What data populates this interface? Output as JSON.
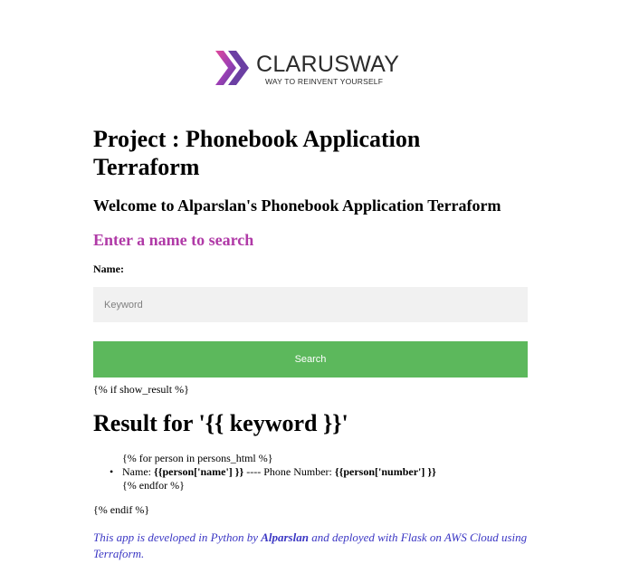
{
  "logo": {
    "name": "CLARUSWAY",
    "tagline": "WAY TO REINVENT YOURSELF",
    "icon": "clarusway-chevrons-logo",
    "colors": [
      "#e0499b",
      "#9b3fb5",
      "#5a3f98"
    ]
  },
  "header": {
    "title": "Project : Phonebook Application Terraform",
    "welcome": "Welcome to Alparslan's Phonebook Application Terraform"
  },
  "search": {
    "heading": "Enter a name to search",
    "label": "Name:",
    "placeholder": "Keyword",
    "value": "",
    "button": "Search"
  },
  "template": {
    "if_line": "{% if show_result %}",
    "result_heading": "Result for '{{ keyword }}'",
    "for_line": "{% for person in persons_html %}",
    "name_prefix": "Name: ",
    "name_expr": "{{person['name'] }}",
    "separator": " ---- Phone Number: ",
    "number_expr": "{{person['number'] }}",
    "endfor_line": "{% endfor %}",
    "endif_line": "{% endif %}",
    "bullet": "•"
  },
  "footer": {
    "prefix": "This app is developed in Python by ",
    "author": "Alparslan",
    "suffix": " and deployed with Flask on AWS Cloud using Terraform."
  },
  "colors": {
    "heading_purple": "#b03aa7",
    "button_green": "#5cb85c",
    "footer_blue": "#3b37c4",
    "input_bg": "#f1f1f1"
  }
}
